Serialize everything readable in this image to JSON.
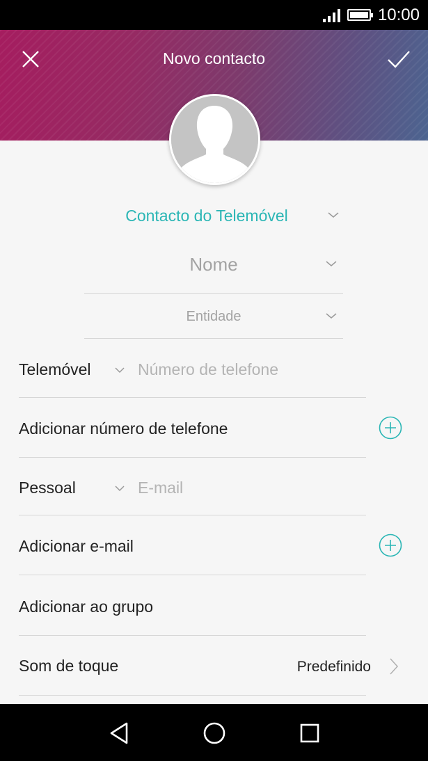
{
  "status_bar": {
    "time": "10:00"
  },
  "header": {
    "title": "Novo contacto",
    "gradient_start": "#a51d5f",
    "gradient_end": "#4c6490"
  },
  "account": {
    "label": "Contacto do Telemóvel",
    "color": "#2bb6b5"
  },
  "name_field": {
    "placeholder": "Nome"
  },
  "entity_field": {
    "placeholder": "Entidade"
  },
  "phone": {
    "type_label": "Telemóvel",
    "placeholder": "Número de telefone"
  },
  "add_phone": {
    "label": "Adicionar número de telefone",
    "icon": "add-circle-icon"
  },
  "email": {
    "type_label": "Pessoal",
    "placeholder": "E-mail"
  },
  "add_email": {
    "label": "Adicionar e-mail",
    "icon": "add-circle-icon"
  },
  "add_group": {
    "label": "Adicionar ao grupo"
  },
  "ringtone": {
    "label": "Som de toque",
    "value": "Predefinido"
  },
  "nav": {
    "back_icon": "back-triangle-icon",
    "home_icon": "home-circle-icon",
    "recents_icon": "recents-square-icon"
  }
}
